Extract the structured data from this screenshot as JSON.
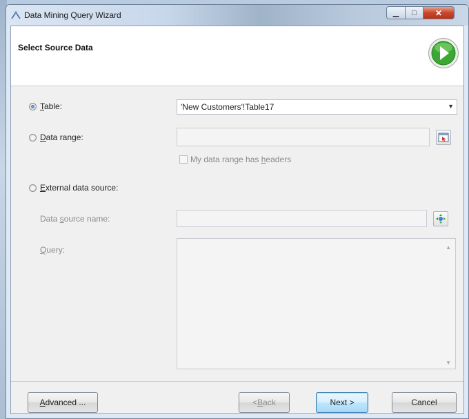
{
  "window": {
    "title": "Data Mining Query Wizard",
    "close_glyph": "✕",
    "minimize_glyph": "▁",
    "maximize_glyph": "□"
  },
  "header": {
    "title": "Select Source Data",
    "icon": "green-arrow-forward-icon"
  },
  "options": {
    "table": {
      "label_first": "T",
      "label_rest": "able:",
      "value": "'New Customers'!Table17",
      "selected": true
    },
    "data_range": {
      "label_first": "D",
      "label_rest": "ata range:",
      "value": "",
      "selected": false,
      "picker_icon": "range-select-icon"
    },
    "has_headers": {
      "label_pre": "My data range has ",
      "label_ul": "h",
      "label_post": "eaders",
      "checked": false
    },
    "external": {
      "label_first": "E",
      "label_rest": "xternal data source:",
      "selected": false
    },
    "data_source_name": {
      "label_pre": "Data ",
      "label_ul": "s",
      "label_post": "ource name:",
      "value": "",
      "picker_icon": "connection-icon"
    },
    "query": {
      "label_ul": "Q",
      "label_rest": "uery:",
      "value": ""
    }
  },
  "footer": {
    "advanced": {
      "ul": "A",
      "rest": "dvanced ..."
    },
    "back": {
      "pre": "< ",
      "ul": "B",
      "rest": "ack"
    },
    "next": {
      "label": "Next >"
    },
    "cancel": {
      "label": "Cancel"
    }
  },
  "colors": {
    "accent": "#2a5fa6",
    "go_icon": "#3aa832",
    "close": "#c9462c"
  }
}
